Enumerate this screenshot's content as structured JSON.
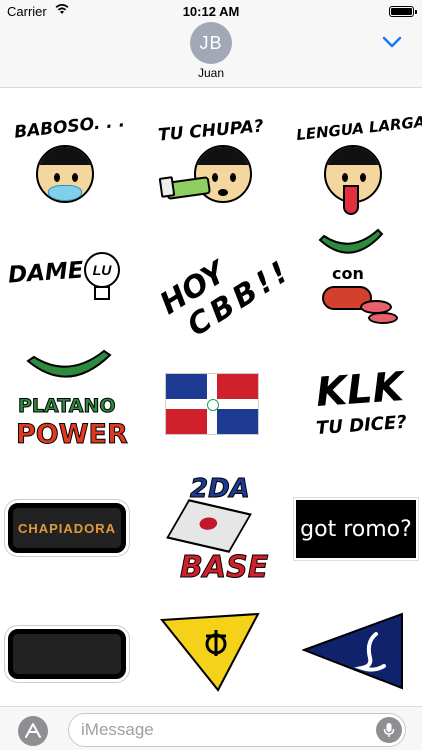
{
  "status_bar": {
    "carrier": "Carrier",
    "time": "10:12 AM"
  },
  "header": {
    "avatar_initials": "JB",
    "contact_name": "Juan"
  },
  "stickers": [
    {
      "caption": "BABOSO. . ."
    },
    {
      "caption": "TU CHUPA?"
    },
    {
      "caption": "LENGUA LARGA!"
    },
    {
      "caption": "DAME",
      "bulb_text": "LU"
    },
    {
      "caption_line1": "HOY",
      "caption_line2": "CBB!!"
    },
    {
      "caption": "con"
    },
    {
      "caption_line1": "PLATANO",
      "caption_line2": "POWER"
    },
    {
      "caption": ""
    },
    {
      "caption_line1": "KLK",
      "caption_line2": "TU DICE?"
    },
    {
      "caption": "CHAPIADORA"
    },
    {
      "caption_line1": "2DA",
      "caption_line2": "BASE"
    },
    {
      "caption": "got romo?"
    },
    {
      "caption": ""
    },
    {
      "caption": ""
    },
    {
      "caption": ""
    }
  ],
  "input_bar": {
    "placeholder": "iMessage"
  },
  "colors": {
    "header_bg": "#f7f7f7",
    "accent_blue": "#1a7cf5",
    "avatar_gray": "#a2a8b5",
    "plantain_green": "#2e8b3e",
    "power_red": "#e03a1e",
    "flag_blue": "#1f3a93",
    "flag_red": "#d0202b",
    "pennant_yellow": "#f4d21a",
    "pennant_navy": "#10226b"
  }
}
